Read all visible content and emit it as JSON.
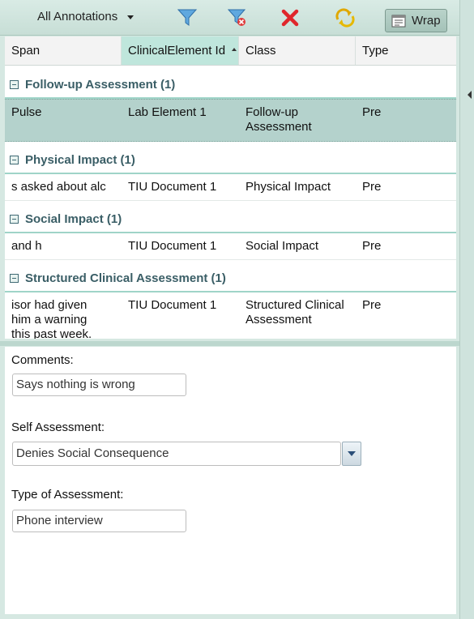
{
  "toolbar": {
    "filter_label": "All Annotations",
    "wrap_label": "Wrap",
    "icons": [
      "filter-icon",
      "clear-filter-icon",
      "delete-icon",
      "refresh-icon",
      "wrap-icon"
    ]
  },
  "columns": [
    "Span",
    "ClinicalElement Id",
    "Class",
    "Type"
  ],
  "groups": [
    {
      "label": "Follow-up Assessment (1)",
      "rows": [
        {
          "span": "Pulse",
          "element": "Lab Element 1",
          "class": "Follow-up Assessment",
          "type": "Pre",
          "selected": true
        }
      ]
    },
    {
      "label": "Physical Impact (1)",
      "rows": [
        {
          "span": "s asked about alc",
          "element": "TIU Document 1",
          "class": "Physical Impact",
          "type": "Pre"
        }
      ]
    },
    {
      "label": "Social Impact (1)",
      "rows": [
        {
          "span": "and h",
          "element": "TIU Document 1",
          "class": "Social Impact",
          "type": "Pre"
        }
      ]
    },
    {
      "label": "Structured Clinical Assessment (1)",
      "rows": [
        {
          "span": "isor had given him a warning this past week.",
          "element": "TIU Document 1",
          "class": "Structured Clinical Assessment",
          "type": "Pre"
        }
      ]
    }
  ],
  "form": {
    "comments_label": "Comments:",
    "comments_value": "Says nothing is wrong",
    "self_assessment_label": "Self Assessment:",
    "self_assessment_value": "Denies Social Consequence",
    "type_label": "Type of Assessment:",
    "type_value": "Phone interview"
  },
  "colors": {
    "accent": "#9fd4c8",
    "selected_row": "#b4d2cc",
    "group_text": "#3a5e66"
  }
}
